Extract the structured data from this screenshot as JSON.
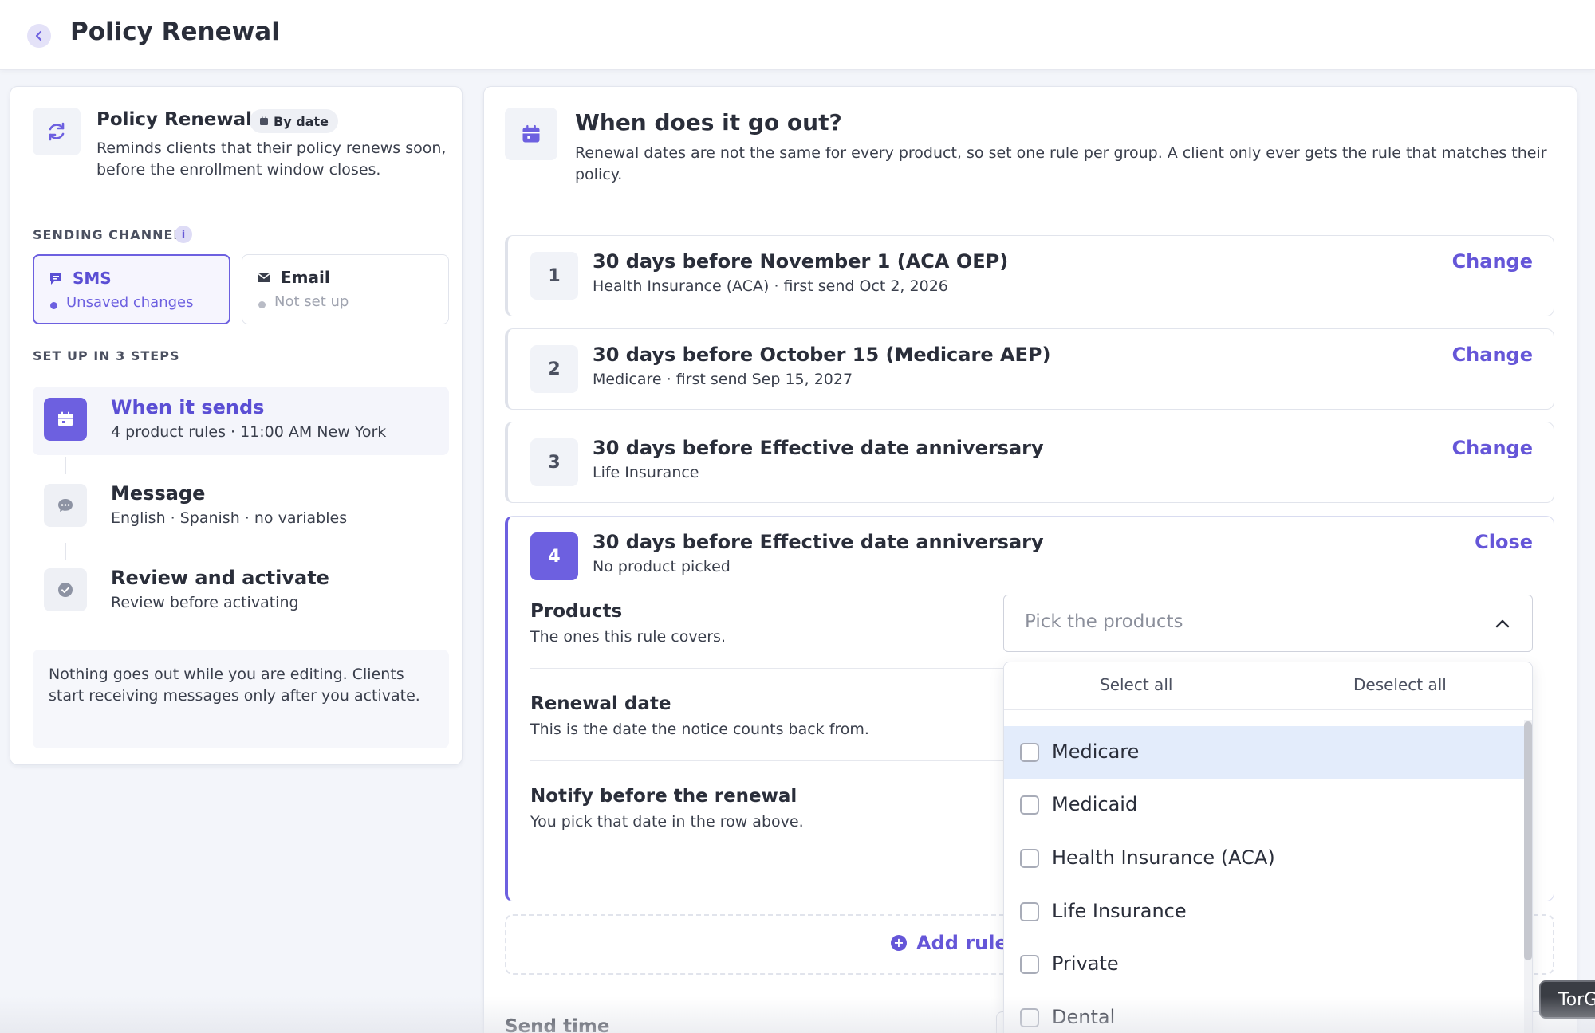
{
  "header": {
    "title": "Policy Renewal"
  },
  "colors": {
    "accent": "#6d60e0",
    "link": "#6556d8",
    "highlight": "#e3ecfb"
  },
  "sidebar": {
    "title": "Policy Renewal",
    "badge": "By date",
    "description": "Reminds clients that their policy renews soon, before the enrollment window closes.",
    "sending_channel_label": "SENDING CHANNEL",
    "info_glyph": "i",
    "channels": [
      {
        "name": "SMS",
        "status": "Unsaved changes",
        "icon": "sms-icon"
      },
      {
        "name": "Email",
        "status": "Not set up",
        "icon": "mail-icon"
      }
    ],
    "steps_label": "SET UP IN 3 STEPS",
    "steps": [
      {
        "title": "When it sends",
        "subtitle": "4 product rules · 11:00 AM New York",
        "icon": "calendar-icon"
      },
      {
        "title": "Message",
        "subtitle": "English · Spanish · no variables",
        "icon": "chat-icon"
      },
      {
        "title": "Review and activate",
        "subtitle": "Review before activating",
        "icon": "check-circle-icon"
      }
    ],
    "note": "Nothing goes out while you are editing. Clients start receiving messages only after you activate."
  },
  "main": {
    "title": "When does it go out?",
    "description": "Renewal dates are not the same for every product, so set one rule per group. A client only ever gets the rule that matches their policy.",
    "rules": [
      {
        "number": "1",
        "title": "30 days before November 1 (ACA OEP)",
        "subtitle": "Health Insurance (ACA) · first send Oct 2, 2026",
        "action": "Change"
      },
      {
        "number": "2",
        "title": "30 days before October 15 (Medicare AEP)",
        "subtitle": "Medicare · first send Sep 15, 2027",
        "action": "Change"
      },
      {
        "number": "3",
        "title": "30 days before Effective date anniversary",
        "subtitle": "Life Insurance",
        "action": "Change"
      },
      {
        "number": "4",
        "title": "30 days before Effective date anniversary",
        "subtitle": "No product picked",
        "action": "Close"
      }
    ],
    "rule4_fields": {
      "products": {
        "title": "Products",
        "subtitle": "The ones this rule covers."
      },
      "renewal_date": {
        "title": "Renewal date",
        "subtitle": "This is the date the notice counts back from."
      },
      "notify": {
        "title": "Notify before the renewal",
        "subtitle": "You pick that date in the row above."
      }
    },
    "products_select": {
      "placeholder": "Pick the products",
      "select_all": "Select all",
      "deselect_all": "Deselect all",
      "options": [
        "Medicare",
        "Medicaid",
        "Health Insurance (ACA)",
        "Life Insurance",
        "Private",
        "Dental"
      ]
    },
    "add_rule_label": "Add rule f",
    "send_time_label": "Send time"
  },
  "tooltip": "TorG"
}
